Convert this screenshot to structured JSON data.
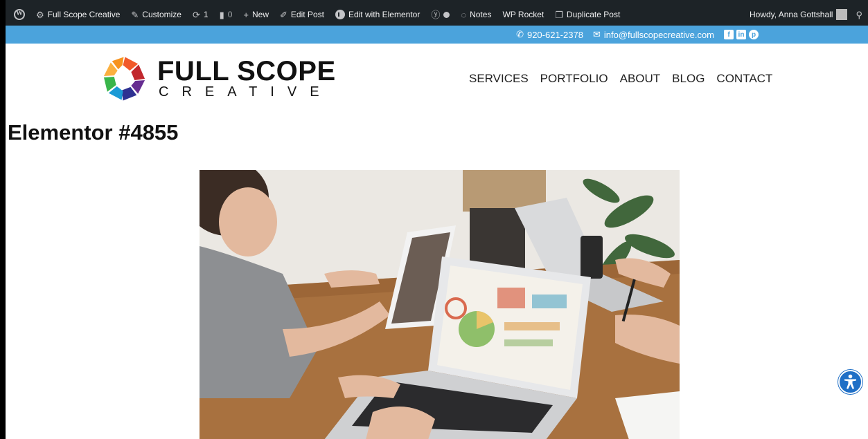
{
  "adminbar": {
    "site_name": "Full Scope Creative",
    "customize": "Customize",
    "updates_count": "1",
    "comments_count": "0",
    "new": "New",
    "edit_post": "Edit Post",
    "edit_elementor": "Edit with Elementor",
    "notes": "Notes",
    "wp_rocket": "WP Rocket",
    "duplicate_post": "Duplicate Post",
    "howdy": "Howdy, Anna Gottshall"
  },
  "contact": {
    "phone": "920-621-2378",
    "email": "info@fullscopecreative.com"
  },
  "logo": {
    "line1": "FULL SCOPE",
    "line2": "CREATIVE"
  },
  "nav": {
    "items": [
      "SERVICES",
      "PORTFOLIO",
      "ABOUT",
      "BLOG",
      "CONTACT"
    ]
  },
  "page": {
    "title": "Elementor #4855"
  },
  "colors": {
    "adminbar_bg": "#1d2327",
    "contactbar_bg": "#4ba3dc",
    "a11y_button": "#1f6fc6"
  }
}
